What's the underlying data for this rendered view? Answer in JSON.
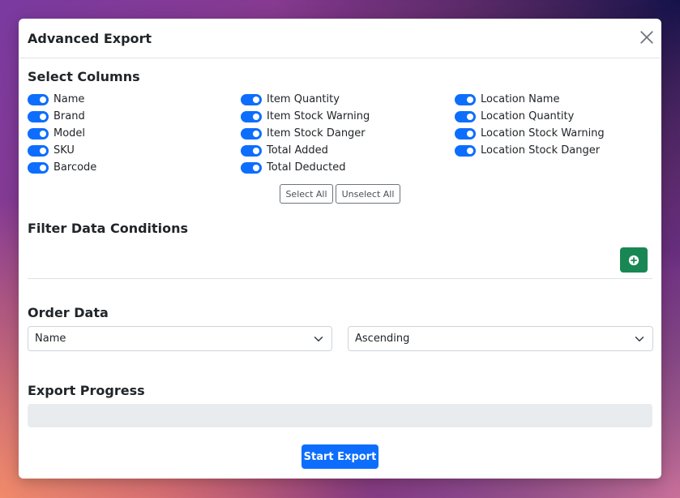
{
  "modal": {
    "title": "Advanced Export"
  },
  "columns": {
    "heading": "Select Columns",
    "group1": [
      "Name",
      "Brand",
      "Model",
      "SKU",
      "Barcode"
    ],
    "group2": [
      "Item Quantity",
      "Item Stock Warning",
      "Item Stock Danger",
      "Total Added",
      "Total Deducted"
    ],
    "group3": [
      "Location Name",
      "Location Quantity",
      "Location Stock Warning",
      "Location Stock Danger"
    ],
    "all_checked": true,
    "select_all_label": "Select All",
    "unselect_all_label": "Unselect All"
  },
  "filter": {
    "heading": "Filter Data Conditions",
    "add_icon": "plus-circle-icon"
  },
  "order": {
    "heading": "Order Data",
    "field_value": "Name",
    "direction_value": "Ascending"
  },
  "progress": {
    "heading": "Export Progress",
    "value": 0
  },
  "actions": {
    "start_label": "Start Export"
  },
  "colors": {
    "primary": "#0d6efd",
    "success": "#198754"
  }
}
